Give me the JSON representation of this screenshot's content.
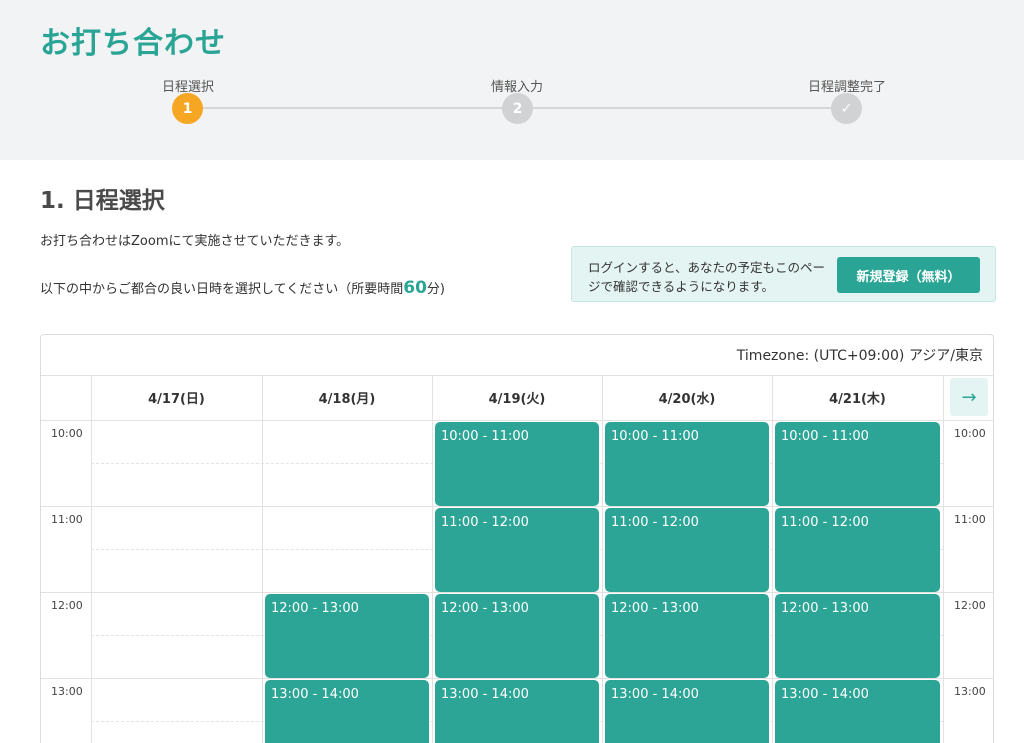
{
  "header": {
    "title": "お打ち合わせ",
    "steps": [
      {
        "label": "日程選択",
        "number": "1"
      },
      {
        "label": "情報入力",
        "number": "2"
      },
      {
        "label": "日程調整完了",
        "number": "✓"
      }
    ]
  },
  "main": {
    "section_title": "1. 日程選択",
    "intro": "お打ち合わせはZoomにて実施させていただきます。",
    "instruction": "以下の中からご都合の良い日時を選択してください（所要時間",
    "duration_value": "60",
    "duration_unit": "分)"
  },
  "login_prompt": {
    "text": "ログインすると、あなたの予定もこのページで確認できるようになります。",
    "register_label": "新規登録（無料）"
  },
  "calendar": {
    "timezone": "Timezone: (UTC+09:00) アジア/東京",
    "days": [
      "4/17(日)",
      "4/18(月)",
      "4/19(火)",
      "4/20(水)",
      "4/21(木)"
    ],
    "hours": [
      "10:00",
      "11:00",
      "12:00",
      "13:00"
    ],
    "next_icon": "arrow-right-icon",
    "slots": [
      {
        "day": 2,
        "hour": 0,
        "label": "10:00 - 11:00"
      },
      {
        "day": 3,
        "hour": 0,
        "label": "10:00 - 11:00"
      },
      {
        "day": 4,
        "hour": 0,
        "label": "10:00 - 11:00"
      },
      {
        "day": 2,
        "hour": 1,
        "label": "11:00 - 12:00"
      },
      {
        "day": 3,
        "hour": 1,
        "label": "11:00 - 12:00"
      },
      {
        "day": 4,
        "hour": 1,
        "label": "11:00 - 12:00"
      },
      {
        "day": 1,
        "hour": 2,
        "label": "12:00 - 13:00"
      },
      {
        "day": 2,
        "hour": 2,
        "label": "12:00 - 13:00"
      },
      {
        "day": 3,
        "hour": 2,
        "label": "12:00 - 13:00"
      },
      {
        "day": 4,
        "hour": 2,
        "label": "12:00 - 13:00"
      },
      {
        "day": 1,
        "hour": 3,
        "label": "13:00 - 14:00"
      },
      {
        "day": 2,
        "hour": 3,
        "label": "13:00 - 14:00"
      },
      {
        "day": 3,
        "hour": 3,
        "label": "13:00 - 14:00"
      },
      {
        "day": 4,
        "hour": 3,
        "label": "13:00 - 14:00"
      }
    ]
  },
  "colors": {
    "brand": "#2aa595",
    "active_step": "#f5a623",
    "slot": "#2da596",
    "header_bg": "#f2f3f4"
  }
}
